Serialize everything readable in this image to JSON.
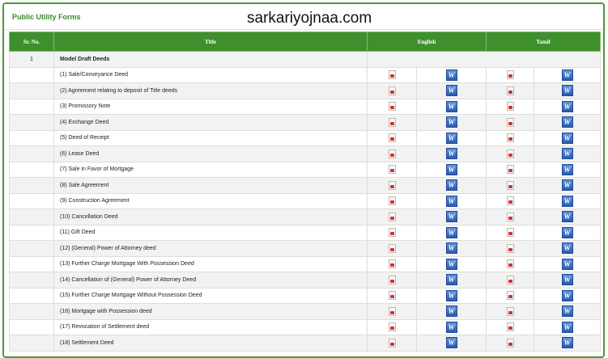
{
  "panel": {
    "title": "Public Utility Forms"
  },
  "watermark": "sarkariyojnaa.com",
  "table": {
    "headers": {
      "sr": "Sr. No.",
      "title": "Title",
      "english": "English",
      "tamil": "Tamil"
    },
    "group": {
      "sr": "1",
      "title": "Model Draft Deeds"
    },
    "rows": [
      "(1) Sale/Conveyance Deed",
      "(2) Agreement relating to deposit of Title deeds",
      "(3) Promissory Note",
      "(4) Exchange Deed",
      "(5) Deed of Receipt",
      "(6) Lease Deed",
      "(7) Sale in Favor of Mortgage",
      "(8) Sale Agreement",
      "(9) Construction Agreement",
      "(10) Cancellation Deed",
      "(11) Gift Deed",
      "(12) (General) Power of Attorney deed",
      "(13) Further Charge Mortgage With Possession Deed",
      "(14) Cancellation of (General) Power of Attorney Deed",
      "(15) Further Charge Mortgage Without Possession Deed",
      "(16) Mortgage with Possession deed",
      "(17) Revocation of Settlement deed",
      "(18) Settlement Deed"
    ],
    "icons": {
      "pdf": "pdf-file-icon",
      "word": "word-document-icon",
      "word_glyph": "W"
    }
  }
}
